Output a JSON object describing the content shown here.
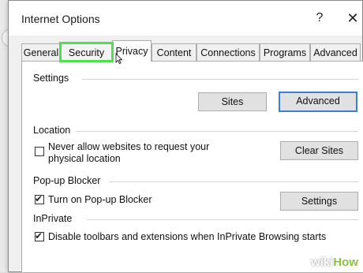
{
  "window": {
    "title": "Internet Options",
    "help_glyph": "?",
    "close_glyph": "✕"
  },
  "tabs": [
    {
      "label": "General"
    },
    {
      "label": "Security"
    },
    {
      "label": "Privacy"
    },
    {
      "label": "Content"
    },
    {
      "label": "Connections"
    },
    {
      "label": "Programs"
    },
    {
      "label": "Advanced"
    }
  ],
  "active_tab": "Privacy",
  "highlighted_tab": "Security",
  "settings": {
    "heading": "Settings",
    "sites_button": "Sites",
    "advanced_button": "Advanced"
  },
  "location": {
    "heading": "Location",
    "never_allow_line1": "Never allow websites to request your",
    "never_allow_line2": "physical location",
    "never_allow_checked": false,
    "clear_sites_button": "Clear Sites"
  },
  "popup": {
    "heading": "Pop-up Blocker",
    "turn_on_label": "Turn on Pop-up Blocker",
    "turn_on_checked": true,
    "settings_button": "Settings"
  },
  "inprivate": {
    "heading": "InPrivate",
    "disable_label": "Disable toolbars and extensions when InPrivate Browsing starts",
    "disable_checked": true
  },
  "watermark": {
    "part1": "wiki",
    "part2": "How"
  },
  "colors": {
    "highlight": "#4ee04e",
    "focus_border": "#3c7fd1"
  }
}
